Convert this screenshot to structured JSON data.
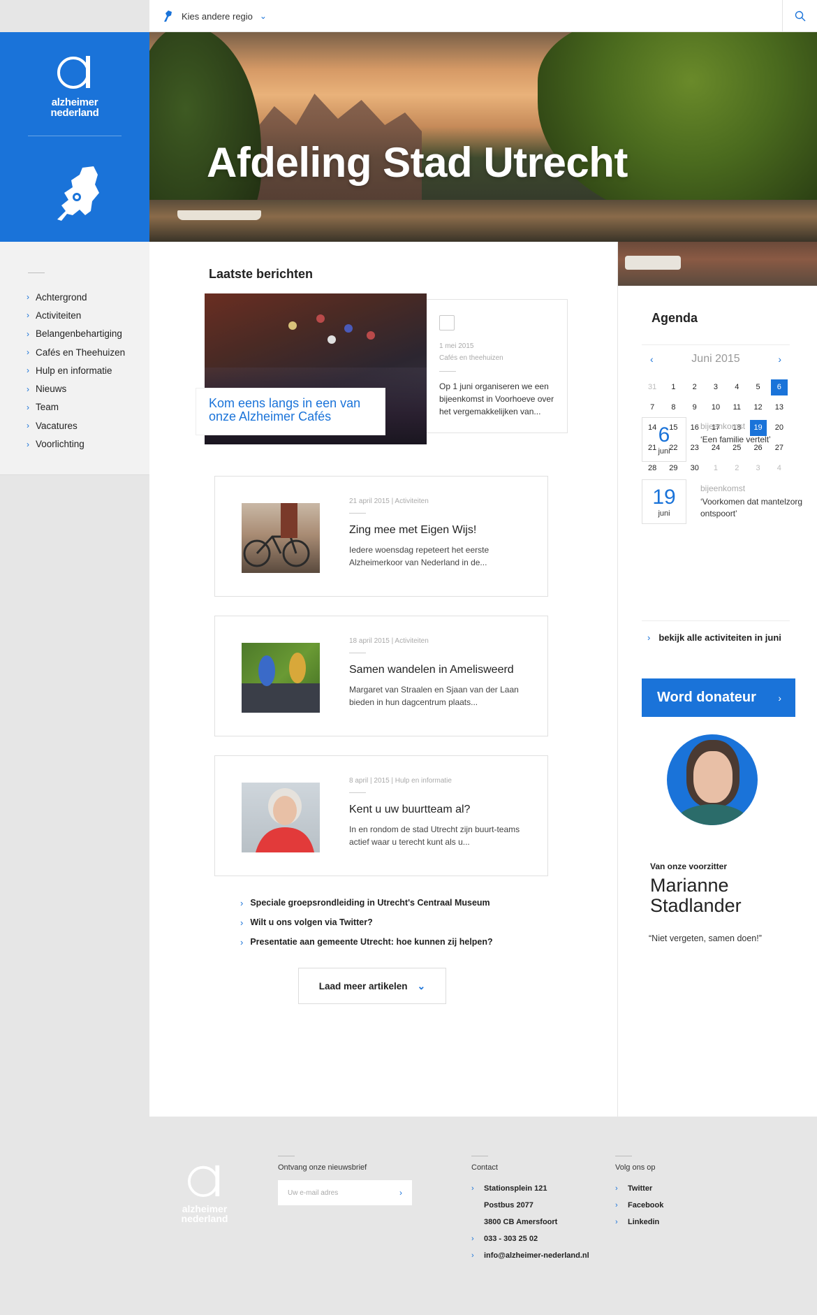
{
  "topbar": {
    "region_label": "Kies andere regio"
  },
  "brand": {
    "logo_line1": "alzheimer",
    "logo_line2": "nederland"
  },
  "hero": {
    "title": "Afdeling Stad Utrecht"
  },
  "leftnav": {
    "items": [
      {
        "label": "Achtergrond"
      },
      {
        "label": "Activiteiten"
      },
      {
        "label": "Belangenbehartiging"
      },
      {
        "label": "Cafés en Theehuizen"
      },
      {
        "label": "Hulp en informatie"
      },
      {
        "label": "Nieuws"
      },
      {
        "label": "Team"
      },
      {
        "label": "Vacatures"
      },
      {
        "label": "Voorlichting"
      }
    ]
  },
  "main": {
    "section_title": "Laatste berichten",
    "featured": {
      "caption": "Kom eens langs in een van onze Alzheimer Cafés",
      "date": "1 mei 2015",
      "category": "Cafés en theehuizen",
      "text": "Op 1 juni organiseren we een bijeenkomst in Voorhoeve over het vergemakkelijken van..."
    },
    "articles": [
      {
        "meta": "21 april 2015  |  Activiteiten",
        "title": "Zing mee met Eigen Wijs!",
        "text": "Iedere woensdag repeteert het eerste Alzheimerkoor van Nederland in de..."
      },
      {
        "meta": "18 april 2015  |  Activiteiten",
        "title": "Samen wandelen in Amelisweerd",
        "text": "Margaret van Straalen en Sjaan van der Laan bieden in hun dagcentrum plaats..."
      },
      {
        "meta": "8 april  |  2015  |  Hulp en informatie",
        "title": "Kent u uw buurtteam al?",
        "text": "In en rondom de stad Utrecht zijn buurt-teams actief waar u terecht kunt als u..."
      }
    ],
    "links": [
      {
        "label": "Speciale groepsrondleiding in Utrecht's Centraal Museum"
      },
      {
        "label": "Wilt u ons volgen via Twitter?"
      },
      {
        "label": "Presentatie aan gemeente Utrecht: hoe kunnen zij helpen?"
      }
    ],
    "load_more": "Laad meer artikelen"
  },
  "agenda": {
    "title": "Agenda",
    "month": "Juni 2015",
    "days": [
      {
        "d": "31",
        "out": true
      },
      {
        "d": "1"
      },
      {
        "d": "2"
      },
      {
        "d": "3"
      },
      {
        "d": "4"
      },
      {
        "d": "5"
      },
      {
        "d": "6",
        "hl": true
      },
      {
        "d": "7"
      },
      {
        "d": "8"
      },
      {
        "d": "9"
      },
      {
        "d": "10"
      },
      {
        "d": "11"
      },
      {
        "d": "12"
      },
      {
        "d": "13"
      },
      {
        "d": "14"
      },
      {
        "d": "15"
      },
      {
        "d": "16"
      },
      {
        "d": "17"
      },
      {
        "d": "18"
      },
      {
        "d": "19",
        "hl": true
      },
      {
        "d": "20"
      },
      {
        "d": "21"
      },
      {
        "d": "22"
      },
      {
        "d": "23"
      },
      {
        "d": "24"
      },
      {
        "d": "25"
      },
      {
        "d": "26"
      },
      {
        "d": "27"
      },
      {
        "d": "28"
      },
      {
        "d": "29"
      },
      {
        "d": "30"
      },
      {
        "d": "1",
        "out": true
      },
      {
        "d": "2",
        "out": true
      },
      {
        "d": "3",
        "out": true
      },
      {
        "d": "4",
        "out": true
      }
    ],
    "events": [
      {
        "day": "6",
        "month": "juni",
        "kind": "bijeenkomst",
        "name": "‘Een familie vertelt’"
      },
      {
        "day": "19",
        "month": "juni",
        "kind": "bijeenkomst",
        "name": "‘Voorkomen dat mantelzorg ontspoort’"
      }
    ],
    "all_link": "bekijk alle activiteiten in juni"
  },
  "donate": {
    "label": "Word donateur"
  },
  "chair": {
    "label": "Van onze voorzitter",
    "first": "Marianne",
    "last": "Stadlander",
    "quote": "“Niet vergeten, samen doen!”"
  },
  "footer": {
    "logo_line1": "alzheimer",
    "logo_line2": "nederland",
    "newsletter_head": "Ontvang onze nieuwsbrief",
    "newsletter_placeholder": "Uw e-mail adres",
    "contact_head": "Contact",
    "contact": [
      "Stationsplein 121",
      "Postbus 2077",
      "3800 CB Amersfoort",
      "033 - 303 25 02",
      "info@alzheimer-nederland.nl"
    ],
    "social_head": "Volg ons op",
    "social": [
      "Twitter",
      "Facebook",
      "Linkedin"
    ]
  },
  "colors": {
    "brand_blue": "#1a73d9"
  }
}
